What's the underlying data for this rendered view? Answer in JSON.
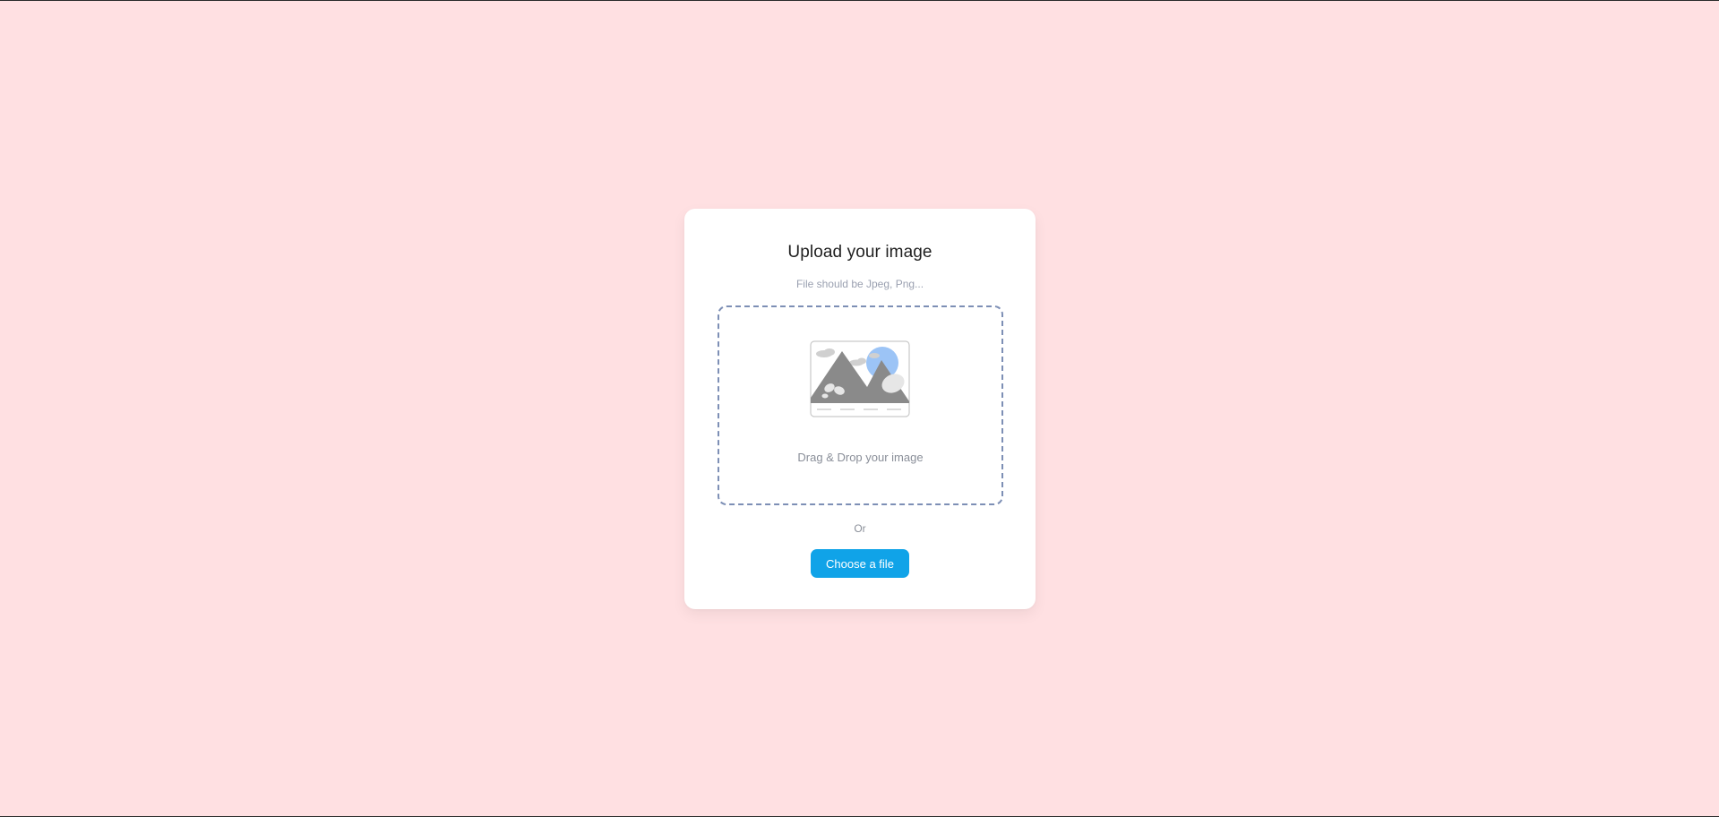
{
  "upload_card": {
    "title": "Upload your image",
    "subtitle": "File should be Jpeg, Png...",
    "dropzone": {
      "label": "Drag & Drop your image",
      "icon": "image-placeholder-icon"
    },
    "divider_text": "Or",
    "choose_button_label": "Choose a file"
  },
  "colors": {
    "background": "#ffe0e2",
    "card": "#ffffff",
    "dropzone_border": "#7d8fb5",
    "button": "#10a3e8",
    "illustration_sun": "#9cc4f6",
    "illustration_mountain": "#8a8a8a"
  }
}
